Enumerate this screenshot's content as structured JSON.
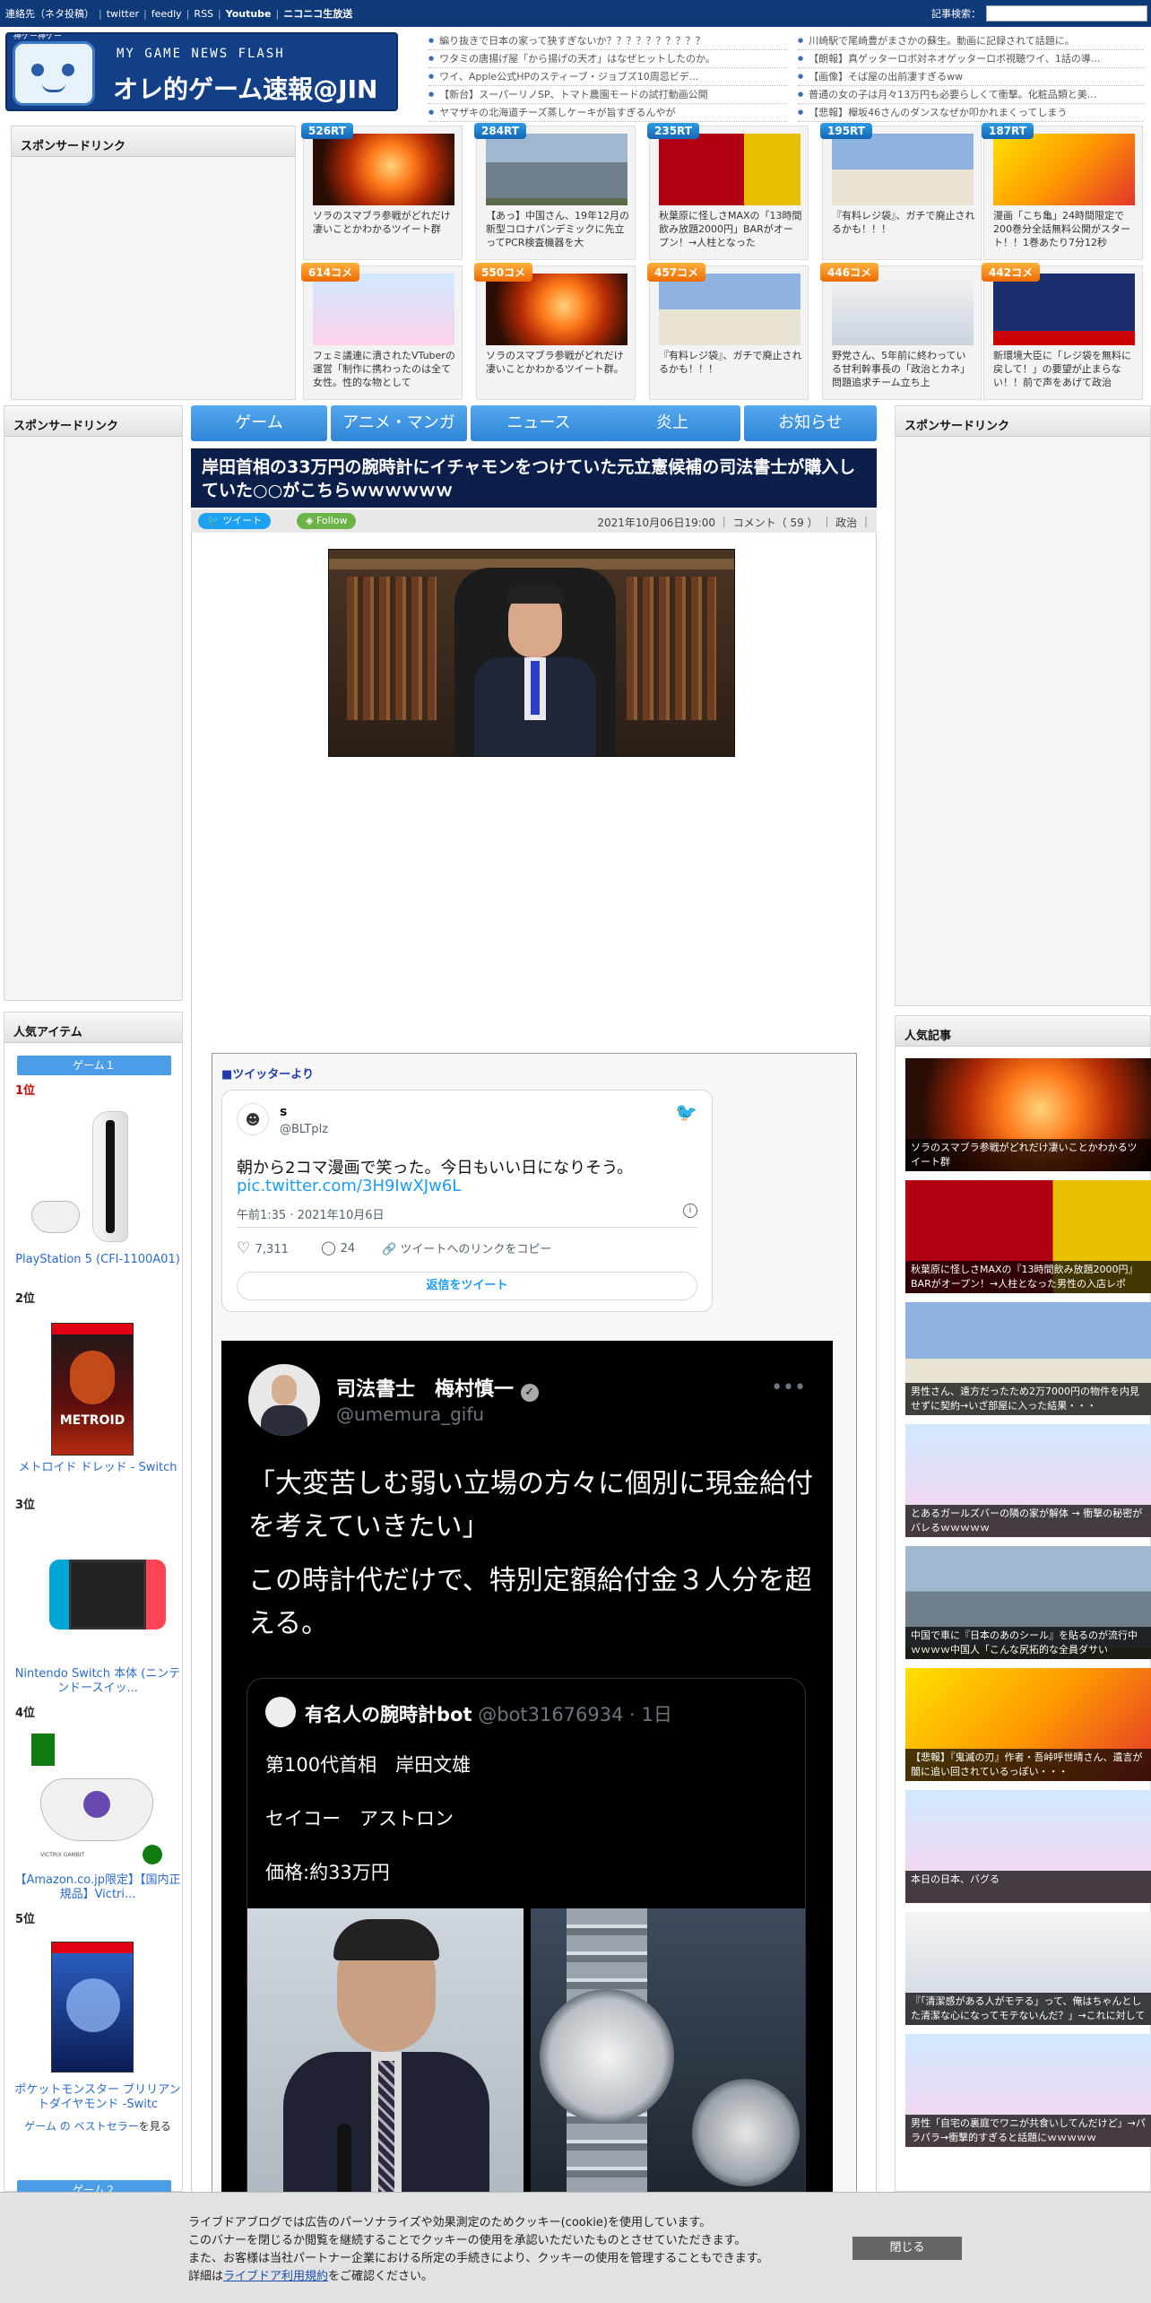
{
  "topbar": {
    "items": [
      "連絡先（ネタ投稿）",
      "twitter",
      "feedly",
      "RSS",
      "Youtube",
      "ニコニコ生放送"
    ],
    "search_label": "記事検索：",
    "search_placeholder": ""
  },
  "logo": {
    "face_text": "神ゲー神ゲー",
    "sub": "MY GAME NEWS FLASH",
    "main": "オレ的ゲーム速報@JIN"
  },
  "headlines_left": [
    "編り抜きで日本の家って狭すぎないか？？？？？？？？？？",
    "ワタミの唐揚げ屋「から揚げの天才」はなぜヒットしたのか。",
    "ワイ、Apple公式HPのスティーブ・ジョブズ10周忌ビデ...",
    "【新台】スーパーリノSP、トマト農園モードの試打動画公開",
    "ヤマザキの北海道チーズ蒸しケーキが旨すぎるんやが"
  ],
  "headlines_right": [
    "川崎駅で尾崎豊がまさかの蘇生。動画に記録されて話題に。",
    "【朗報】真ゲッターロボ対ネオゲッターロボ視聴ワイ、1話の導...",
    "【画像】そば屋の出前凄すぎるww",
    "普通の女の子は月々13万円も必要らしくて衝撃。化粧品類と美...",
    "【悲報】欅坂46さんのダンスなぜか叩かれまくってしまう"
  ],
  "sponsored_label": "スポンサードリンク",
  "cards": [
    {
      "badge": "526RT",
      "kind": "rt",
      "text": "ソラのスマブラ参戦がどれだけ凄いことかわかるツイート群",
      "thumb": "fire"
    },
    {
      "badge": "284RT",
      "kind": "rt",
      "text": "【あっ】中国さん、19年12月の新型コロナパンデミックに先立ってPCR検査機器を大",
      "thumb": "building"
    },
    {
      "badge": "235RT",
      "kind": "rt",
      "text": "秋葉原に怪しさMAXの「13時間飲み放題2000円」BARがオープン！→人柱となった",
      "thumb": "bar"
    },
    {
      "badge": "195RT",
      "kind": "rt",
      "text": "『有料レジ袋』、ガチで廃止されるかも！！！",
      "thumb": "store"
    },
    {
      "badge": "187RT",
      "kind": "rt",
      "text": "漫画「こち亀」24時間限定で200巻分全話無料公開がスタート！！1巻あたり7分12秒",
      "thumb": "manga"
    },
    {
      "badge": "614コメ",
      "kind": "cm",
      "text": "フェミ議連に潰されたVTuberの運営「制作に携わったのは全て女性。性的な物として",
      "thumb": "anime"
    },
    {
      "badge": "550コメ",
      "kind": "cm",
      "text": "ソラのスマブラ参戦がどれだけ凄いことかわかるツイート群。",
      "thumb": "fire"
    },
    {
      "badge": "457コメ",
      "kind": "cm",
      "text": "『有料レジ袋』、ガチで廃止されるかも！！！",
      "thumb": "store"
    },
    {
      "badge": "446コメ",
      "kind": "cm",
      "text": "野党さん、5年前に終わっている甘利幹事長の「政治とカネ」問題追求チーム立ち上",
      "thumb": "meeting"
    },
    {
      "badge": "442コメ",
      "kind": "cm",
      "text": "新環境大臣に「レジ袋を無料に戻して！」の要望が止まらない！！前で声をあげて政治",
      "thumb": "person"
    }
  ],
  "nav": [
    "ゲーム",
    "アニメ・マンガ",
    "ニュース",
    "炎上",
    "お知らせ"
  ],
  "article": {
    "title": "岸田首相の33万円の腕時計にイチャモンをつけていた元立憲候補の司法書士が購入していた○○がこちらｗｗｗｗｗｗ",
    "tweet_btn": "ツイート",
    "follow_btn": "Follow",
    "meta": "2021年10月06日19:00 ｜ コメント（ 59 ） ｜ 政治 ｜"
  },
  "twitter_section": {
    "label": "■ツイッターより",
    "tweet1": {
      "name": "s",
      "handle": "@BLTplz",
      "text": "朝から2コマ漫画で笑った。今日もいい日になりそう。",
      "link": "pic.twitter.com/3H9IwXJw6L",
      "time": "午前1:35 · 2021年10月6日",
      "likes": "7,311",
      "replies": "24",
      "copy": "ツイートへのリンクをコピー",
      "reply_btn": "返信をツイート"
    },
    "tweet2": {
      "name": "司法書士　梅村慎一",
      "handle": "@umemura_gifu",
      "text1": "「大変苦しむ弱い立場の方々に個別に現金給付を考えていきたい」",
      "text2": "この時計代だけで、特別定額給付金３人分を超える。",
      "quote_name": "有名人の腕時計bot",
      "quote_handle": "@bot31676934 · 1日",
      "q1": "第100代首相　岸田文雄",
      "q2": "セイコー　アストロン",
      "q3": "価格:約33万円"
    }
  },
  "popular_items": {
    "title": "人気アイテム",
    "tab1": "ゲーム１",
    "tab2": "ゲーム２",
    "ranks": [
      "1位",
      "2位",
      "3位",
      "4位",
      "5位"
    ],
    "items": [
      "PlayStation 5 (CFI-1100A01)",
      "メトロイド ドレッド - Switch",
      "Nintendo Switch 本体 (ニンテンドースイッ...",
      "【Amazon.co.jp限定】【国内正規品】Victri...",
      "ポケットモンスター ブリリアントダイヤモンド -Switc"
    ],
    "best_link": "ゲーム の ベストセラー",
    "best_suffix": "を見る",
    "metroid": "METROID",
    "victrix": "VICTRIX GAMBIT"
  },
  "popular_articles": {
    "title": "人気記事",
    "items": [
      "ソラのスマブラ参戦がどれだけ凄いことかわかるツイート群",
      "秋葉原に怪しさMAXの『13時間飲み放題2000円』BARがオープン！→人柱となった男性の入店レポ",
      "男性さん、遠方だったため2万7000円の物件を内見せずに契約→いざ部屋に入った結果・・・",
      "とあるガールズバーの隣の家が解体 → 衝撃の秘密がバレるｗｗｗｗｗ",
      "中国で車に『日本のあのシール』を貼るのが流行中ｗｗｗｗ中国人「こんな尻拓的な全員ダサい",
      "【悲報】『鬼滅の刃』作者・吾峠呼世晴さん、遺言が闇に追い回されているっぽい・・・",
      "本日の日本、バグる",
      "『「清潔感がある人がモテる」って、俺はちゃんとした清潔な心になってモテないんだ？」→これに対して",
      "男性「自宅の裏庭でワニが共食いしてんだけど」→パラパラ→衝撃的すぎると話題にｗｗｗｗｗ"
    ]
  },
  "cookie": {
    "line1": "ライブドアブログでは広告のパーソナライズや効果測定のためクッキー(cookie)を使用しています。",
    "line2": "このバナーを閉じるか閲覧を継続することでクッキーの使用を承認いただいたものとさせていただきます。",
    "line3": "また、お客様は当社パートナー企業における所定の手続きにより、クッキーの使用を管理することもできます。",
    "line4_pre": "詳細は",
    "line4_link": "ライブドア利用規約",
    "line4_post": "をご確認ください。",
    "close": "閉じる"
  }
}
